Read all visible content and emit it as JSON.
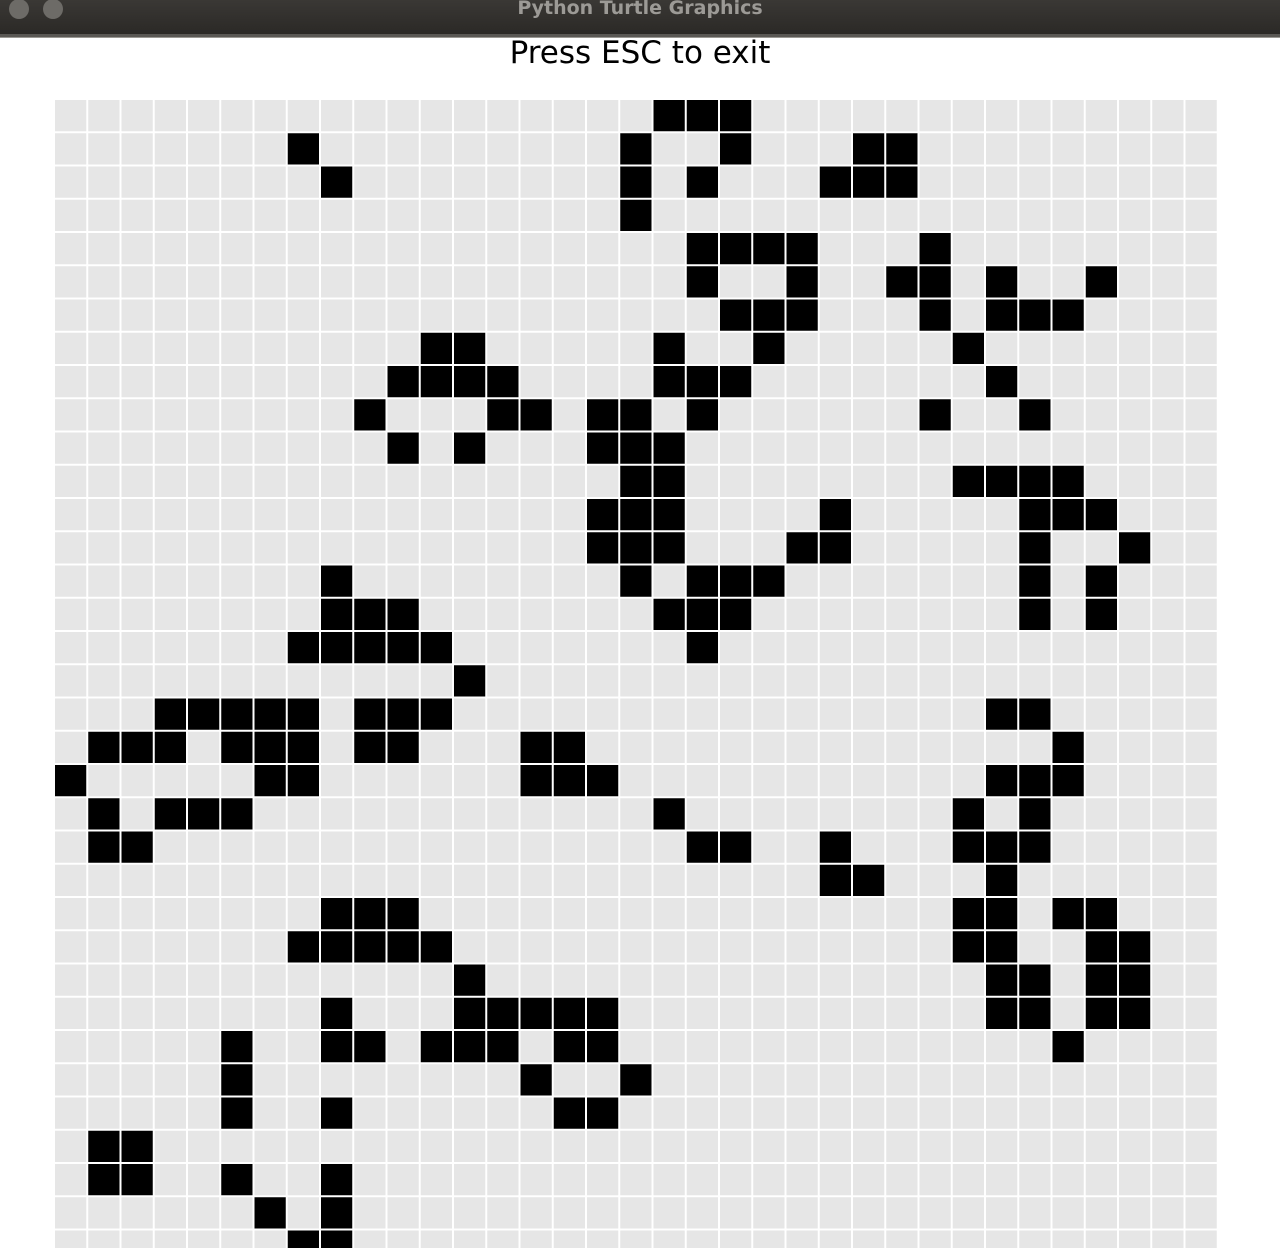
{
  "window": {
    "title": "Python Turtle Graphics"
  },
  "canvas": {
    "instruction": "Press ESC to exit"
  },
  "grid": {
    "columns": 35,
    "visible_rows": 35,
    "colors": {
      "dead": "#e6e6e6",
      "alive": "#000000",
      "grid_line": "#ffffff"
    },
    "live_cells": [
      [
        18,
        0
      ],
      [
        19,
        0
      ],
      [
        20,
        0
      ],
      [
        7,
        1
      ],
      [
        17,
        1
      ],
      [
        20,
        1
      ],
      [
        24,
        1
      ],
      [
        25,
        1
      ],
      [
        8,
        2
      ],
      [
        17,
        2
      ],
      [
        19,
        2
      ],
      [
        23,
        2
      ],
      [
        24,
        2
      ],
      [
        25,
        2
      ],
      [
        17,
        3
      ],
      [
        19,
        4
      ],
      [
        20,
        4
      ],
      [
        21,
        4
      ],
      [
        22,
        4
      ],
      [
        26,
        4
      ],
      [
        19,
        5
      ],
      [
        22,
        5
      ],
      [
        25,
        5
      ],
      [
        26,
        5
      ],
      [
        28,
        5
      ],
      [
        31,
        5
      ],
      [
        20,
        6
      ],
      [
        21,
        6
      ],
      [
        22,
        6
      ],
      [
        26,
        6
      ],
      [
        28,
        6
      ],
      [
        29,
        6
      ],
      [
        30,
        6
      ],
      [
        11,
        7
      ],
      [
        12,
        7
      ],
      [
        18,
        7
      ],
      [
        21,
        7
      ],
      [
        27,
        7
      ],
      [
        10,
        8
      ],
      [
        11,
        8
      ],
      [
        12,
        8
      ],
      [
        13,
        8
      ],
      [
        18,
        8
      ],
      [
        19,
        8
      ],
      [
        20,
        8
      ],
      [
        28,
        8
      ],
      [
        9,
        9
      ],
      [
        13,
        9
      ],
      [
        14,
        9
      ],
      [
        16,
        9
      ],
      [
        17,
        9
      ],
      [
        19,
        9
      ],
      [
        26,
        9
      ],
      [
        29,
        9
      ],
      [
        10,
        10
      ],
      [
        12,
        10
      ],
      [
        16,
        10
      ],
      [
        17,
        10
      ],
      [
        18,
        10
      ],
      [
        17,
        11
      ],
      [
        18,
        11
      ],
      [
        27,
        11
      ],
      [
        28,
        11
      ],
      [
        29,
        11
      ],
      [
        30,
        11
      ],
      [
        16,
        12
      ],
      [
        17,
        12
      ],
      [
        18,
        12
      ],
      [
        23,
        12
      ],
      [
        29,
        12
      ],
      [
        30,
        12
      ],
      [
        31,
        12
      ],
      [
        16,
        13
      ],
      [
        17,
        13
      ],
      [
        18,
        13
      ],
      [
        22,
        13
      ],
      [
        23,
        13
      ],
      [
        29,
        13
      ],
      [
        32,
        13
      ],
      [
        8,
        14
      ],
      [
        17,
        14
      ],
      [
        19,
        14
      ],
      [
        20,
        14
      ],
      [
        21,
        14
      ],
      [
        29,
        14
      ],
      [
        31,
        14
      ],
      [
        8,
        15
      ],
      [
        9,
        15
      ],
      [
        10,
        15
      ],
      [
        18,
        15
      ],
      [
        19,
        15
      ],
      [
        20,
        15
      ],
      [
        29,
        15
      ],
      [
        31,
        15
      ],
      [
        7,
        16
      ],
      [
        8,
        16
      ],
      [
        9,
        16
      ],
      [
        10,
        16
      ],
      [
        11,
        16
      ],
      [
        19,
        16
      ],
      [
        12,
        17
      ],
      [
        3,
        18
      ],
      [
        4,
        18
      ],
      [
        5,
        18
      ],
      [
        6,
        18
      ],
      [
        7,
        18
      ],
      [
        9,
        18
      ],
      [
        10,
        18
      ],
      [
        11,
        18
      ],
      [
        28,
        18
      ],
      [
        29,
        18
      ],
      [
        1,
        19
      ],
      [
        2,
        19
      ],
      [
        3,
        19
      ],
      [
        5,
        19
      ],
      [
        6,
        19
      ],
      [
        7,
        19
      ],
      [
        9,
        19
      ],
      [
        10,
        19
      ],
      [
        14,
        19
      ],
      [
        15,
        19
      ],
      [
        30,
        19
      ],
      [
        0,
        20
      ],
      [
        6,
        20
      ],
      [
        7,
        20
      ],
      [
        14,
        20
      ],
      [
        15,
        20
      ],
      [
        16,
        20
      ],
      [
        28,
        20
      ],
      [
        29,
        20
      ],
      [
        30,
        20
      ],
      [
        1,
        21
      ],
      [
        3,
        21
      ],
      [
        4,
        21
      ],
      [
        5,
        21
      ],
      [
        18,
        21
      ],
      [
        27,
        21
      ],
      [
        29,
        21
      ],
      [
        1,
        22
      ],
      [
        2,
        22
      ],
      [
        19,
        22
      ],
      [
        20,
        22
      ],
      [
        23,
        22
      ],
      [
        27,
        22
      ],
      [
        28,
        22
      ],
      [
        29,
        22
      ],
      [
        23,
        23
      ],
      [
        24,
        23
      ],
      [
        28,
        23
      ],
      [
        8,
        24
      ],
      [
        9,
        24
      ],
      [
        10,
        24
      ],
      [
        27,
        24
      ],
      [
        28,
        24
      ],
      [
        30,
        24
      ],
      [
        31,
        24
      ],
      [
        7,
        25
      ],
      [
        8,
        25
      ],
      [
        9,
        25
      ],
      [
        10,
        25
      ],
      [
        11,
        25
      ],
      [
        27,
        25
      ],
      [
        28,
        25
      ],
      [
        31,
        25
      ],
      [
        32,
        25
      ],
      [
        12,
        26
      ],
      [
        28,
        26
      ],
      [
        29,
        26
      ],
      [
        31,
        26
      ],
      [
        32,
        26
      ],
      [
        8,
        27
      ],
      [
        12,
        27
      ],
      [
        13,
        27
      ],
      [
        14,
        27
      ],
      [
        15,
        27
      ],
      [
        16,
        27
      ],
      [
        28,
        27
      ],
      [
        29,
        27
      ],
      [
        31,
        27
      ],
      [
        32,
        27
      ],
      [
        5,
        28
      ],
      [
        8,
        28
      ],
      [
        9,
        28
      ],
      [
        11,
        28
      ],
      [
        12,
        28
      ],
      [
        13,
        28
      ],
      [
        15,
        28
      ],
      [
        16,
        28
      ],
      [
        30,
        28
      ],
      [
        5,
        29
      ],
      [
        14,
        29
      ],
      [
        17,
        29
      ],
      [
        5,
        30
      ],
      [
        8,
        30
      ],
      [
        15,
        30
      ],
      [
        16,
        30
      ],
      [
        1,
        31
      ],
      [
        2,
        31
      ],
      [
        1,
        32
      ],
      [
        2,
        32
      ],
      [
        5,
        32
      ],
      [
        8,
        32
      ],
      [
        6,
        33
      ],
      [
        8,
        33
      ],
      [
        7,
        34
      ],
      [
        8,
        34
      ]
    ]
  }
}
